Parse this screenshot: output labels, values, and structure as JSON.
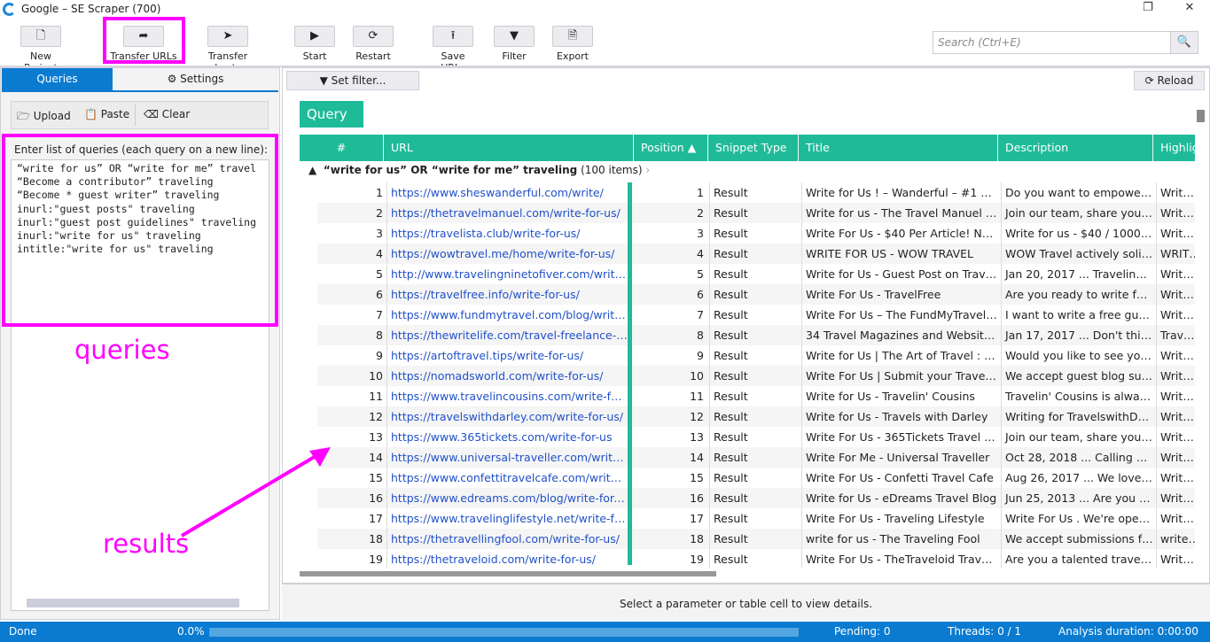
{
  "window": {
    "title": "Google – SE Scraper (700)",
    "controls": [
      "❐",
      "✕"
    ]
  },
  "toolbar": [
    {
      "label": "New Project",
      "icon": "file-icon",
      "glyph": "🗋"
    },
    {
      "label": "Transfer URLs",
      "icon": "share-arrow-icon",
      "glyph": "➦"
    },
    {
      "label": "Transfer hosts",
      "icon": "navigate-arrow-icon",
      "glyph": "➤"
    },
    {
      "label": "Start",
      "icon": "play-icon",
      "glyph": "▶"
    },
    {
      "label": "Restart",
      "icon": "refresh-icon",
      "glyph": "⟳"
    },
    {
      "label": "Save URLs",
      "icon": "upload-icon",
      "glyph": "⭱"
    },
    {
      "label": "Filter",
      "icon": "filter-icon",
      "glyph": "▼"
    },
    {
      "label": "Export",
      "icon": "excel-file-icon",
      "glyph": "🗎"
    }
  ],
  "search": {
    "placeholder": "Search (Ctrl+E)",
    "icon": "search-icon"
  },
  "left": {
    "tabs": {
      "queries": "Queries",
      "settings": "⚙ Settings"
    },
    "tools": {
      "upload": "🗁 Upload",
      "paste": "📋 Paste",
      "clear": "⌫ Clear"
    },
    "label": "Enter list of queries (each query on a new line):",
    "queries": "“write for us” OR “write for me” travel\n“Become a contributor” traveling\n“Become * guest writer” traveling\ninurl:\"guest posts\" traveling\ninurl:\"guest post guidelines\" traveling\ninurl:\"write for us\" traveling\nintitle:\"write for us\" traveling"
  },
  "right": {
    "set_filter": "▼ Set filter...",
    "reload": "⟳ Reload",
    "group_chip": "Query",
    "columns": [
      "#",
      "URL",
      "Position  ▲",
      "Snippet Type",
      "Title",
      "Description",
      "Highlig"
    ],
    "group": {
      "query": "“write for us” OR “write for me” traveling",
      "count": "(100 items)"
    },
    "rows": [
      [
        "1",
        "https://www.sheswanderful.com/write/",
        "1",
        "Result",
        "Write for Us ! – Wanderful – #1 Wo...",
        "Do you want to empower a...",
        "Write fo"
      ],
      [
        "2",
        "https://thetravelmanuel.com/write-for-us/",
        "2",
        "Result",
        "Write for us - The Travel Manuel tra...",
        "Join our team, share your st...",
        "Write fo"
      ],
      [
        "3",
        "https://travelista.club/write-for-us/",
        "3",
        "Result",
        "Write For Us - $40 Per Article! No Ex...",
        "Write for us - $40 / 1000 w...",
        "Write Fo"
      ],
      [
        "4",
        "https://wowtravel.me/home/write-for-us/",
        "4",
        "Result",
        "WRITE FOR US - WOW TRAVEL",
        "WOW Travel actively solicit...",
        "WRITE F"
      ],
      [
        "5",
        "http://www.travelingninetofiver.com/write-fo...",
        "5",
        "Result",
        "Write for Us - Guest Post on Travelin...",
        "Jan 20, 2017 ... Traveling Ni...",
        "Write fo"
      ],
      [
        "6",
        "https://travelfree.info/write-for-us/",
        "6",
        "Result",
        "Write For Us - TravelFree",
        "Are you ready to write for u...",
        "Write Fo"
      ],
      [
        "7",
        "https://www.fundmytravel.com/blog/write-fo...",
        "7",
        "Result",
        "Write For Us – The FundMyTravel Bl...",
        "I want to write a free guest...",
        "Write Fo"
      ],
      [
        "8",
        "https://thewritelife.com/travel-freelance-writ...",
        "8",
        "Result",
        "34 Travel Magazines and Websites T...",
        "Jan 17, 2017 ... Don't think t...",
        "Travel, t"
      ],
      [
        "9",
        "https://artoftravel.tips/write-for-us/",
        "9",
        "Result",
        "Write for Us | The Art of Travel : The...",
        "Would you like to see your...",
        "Write fo"
      ],
      [
        "10",
        "https://nomadsworld.com/write-for-us/",
        "10",
        "Result",
        "Write For Us | Submit your Travel Bl...",
        "We accept guest blog sub...",
        "Write Fo"
      ],
      [
        "11",
        "https://www.travelincousins.com/write-for-u...",
        "11",
        "Result",
        "Write for Us - Travelin' Cousins",
        "Travelin' Cousins is always l...",
        "Write fo"
      ],
      [
        "12",
        "https://travelswithdarley.com/write-for-us/",
        "12",
        "Result",
        "Write for Us - Travels with Darley",
        "Writing for TravelswithDarl...",
        "Write fo"
      ],
      [
        "13",
        "https://www.365tickets.com/write-for-us",
        "13",
        "Result",
        "Write For Us - 365Tickets Travel - At...",
        "Join our team, share your st...",
        "Write Fo"
      ],
      [
        "14",
        "https://www.universal-traveller.com/write-for...",
        "14",
        "Result",
        "Write For Me - Universal Traveller",
        "Oct 28, 2018 ... Calling all bl...",
        "Write Fo"
      ],
      [
        "15",
        "https://www.confettitravelcafe.com/write-for...",
        "15",
        "Result",
        "Write For Us - Confetti Travel Cafe",
        "Aug 26, 2017 ... We love wo...",
        "Write Fo"
      ],
      [
        "16",
        "https://www.edreams.com/blog/write-for-us/",
        "16",
        "Result",
        "Write for Us - eDreams Travel Blog",
        "Jun 25, 2013 ... Are you pas...",
        "Write fo"
      ],
      [
        "17",
        "https://www.travelinglifestyle.net/write-for-us/",
        "17",
        "Result",
        "Write For Us - Traveling Lifestyle",
        "Write For Us . We're open f...",
        "Write Fo"
      ],
      [
        "18",
        "https://thetravellingfool.com/write-for-us/",
        "18",
        "Result",
        "write for us - The Traveling Fool",
        "We accept submissions fro...",
        "write fo"
      ],
      [
        "19",
        "https://thetraveloid.com/write-for-us/",
        "19",
        "Result",
        "Write For Us - TheTraveloid Travel Bl...",
        "Are you a talented travel wr...",
        "Write Fo"
      ]
    ],
    "details": "Select a parameter or table cell to view details."
  },
  "status": {
    "state": "Done",
    "progress": "0.0%",
    "progress_value": 0,
    "pending": "Pending: 0",
    "threads": "Threads: 0 / 1",
    "duration": "Analysis duration: 0:00:00"
  },
  "annotations": {
    "queries": "queries",
    "results": "results",
    "color": "#ff00ff"
  },
  "colors": {
    "accent": "#1fbb99",
    "status_bar": "#0a7bd1",
    "link": "#2050c8"
  }
}
